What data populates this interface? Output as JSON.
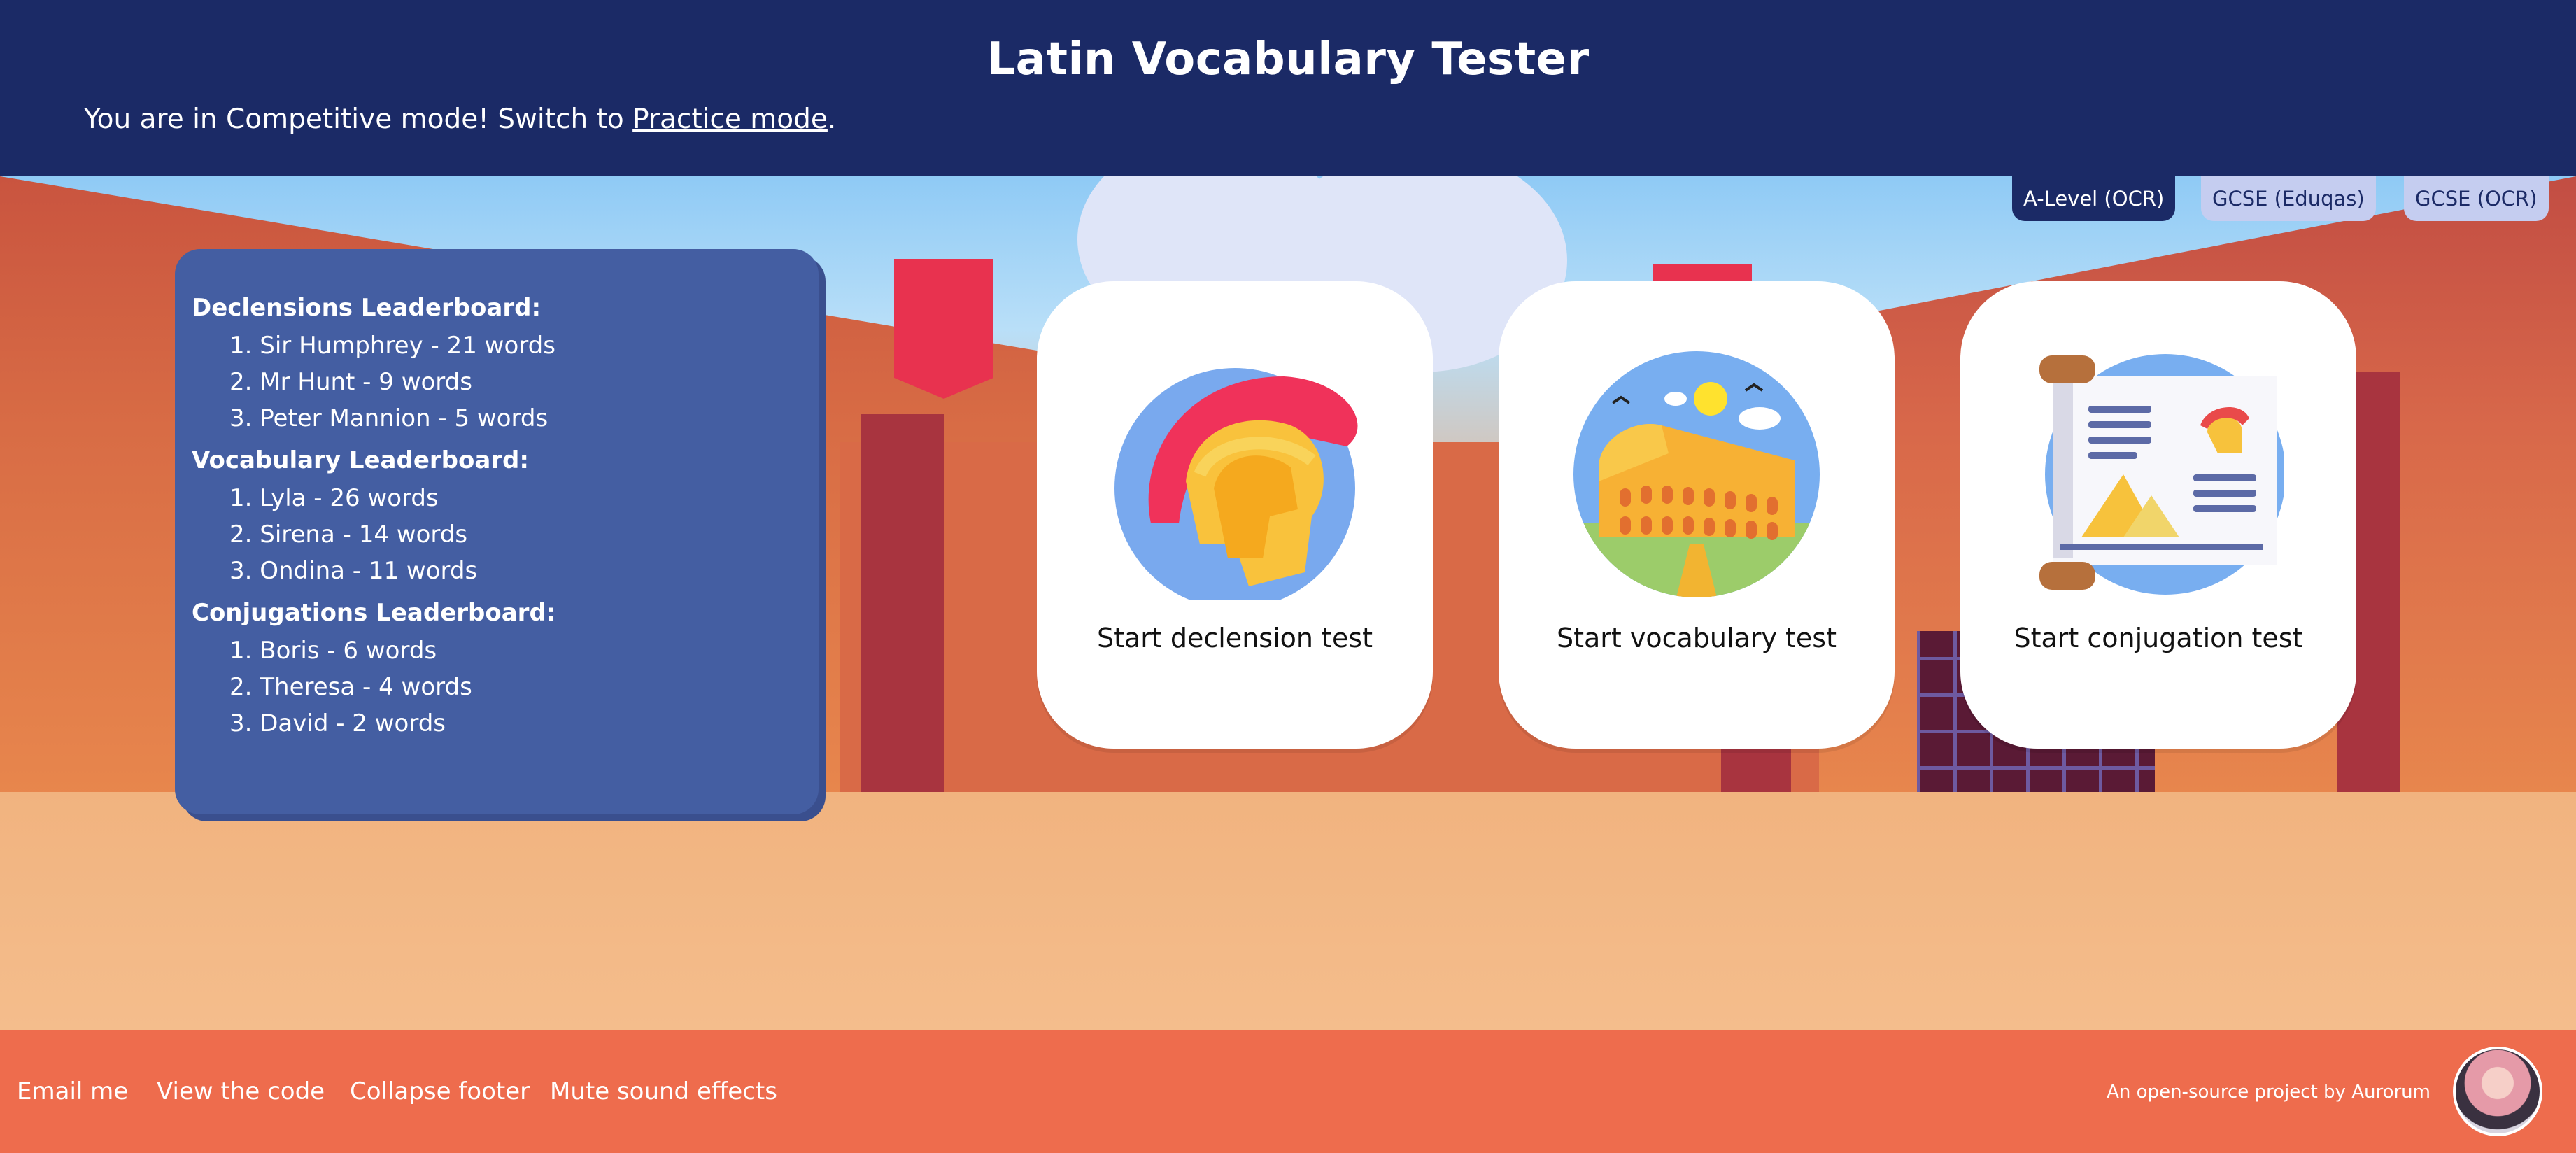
{
  "header": {
    "title": "Latin Vocabulary Tester",
    "mode_prefix": "You are in Competitive mode! Switch to ",
    "mode_link": "Practice mode",
    "mode_suffix": "."
  },
  "level_tabs": [
    {
      "label": "A-Level (OCR)",
      "active": true
    },
    {
      "label": "GCSE (Eduqas)",
      "active": false
    },
    {
      "label": "GCSE (OCR)",
      "active": false
    }
  ],
  "leaderboards": [
    {
      "heading": "Declensions Leaderboard:",
      "entries": [
        "Sir Humphrey - 21 words",
        "Mr Hunt - 9 words",
        "Peter Mannion - 5 words"
      ]
    },
    {
      "heading": "Vocabulary Leaderboard:",
      "entries": [
        "Lyla - 26 words",
        "Sirena - 14 words",
        "Ondina - 11 words"
      ]
    },
    {
      "heading": "Conjugations Leaderboard:",
      "entries": [
        "Boris - 6 words",
        "Theresa - 4 words",
        "David - 2 words"
      ]
    }
  ],
  "tests": [
    {
      "label": "Start declension test",
      "icon": "roman-helmet-icon"
    },
    {
      "label": "Start vocabulary test",
      "icon": "colosseum-icon"
    },
    {
      "label": "Start conjugation test",
      "icon": "scroll-icon"
    }
  ],
  "footer": {
    "links": [
      "Email me",
      "View the code",
      "Collapse footer",
      "Mute sound effects"
    ],
    "credit": "An open-source project by Aurorum"
  },
  "colors": {
    "header_bg": "#1b2a66",
    "leaderboard_bg": "#445ea2",
    "footer_bg": "#ee6c4d",
    "tab_active": "#1b2a66",
    "tab_inactive": "#c5cdf0"
  }
}
